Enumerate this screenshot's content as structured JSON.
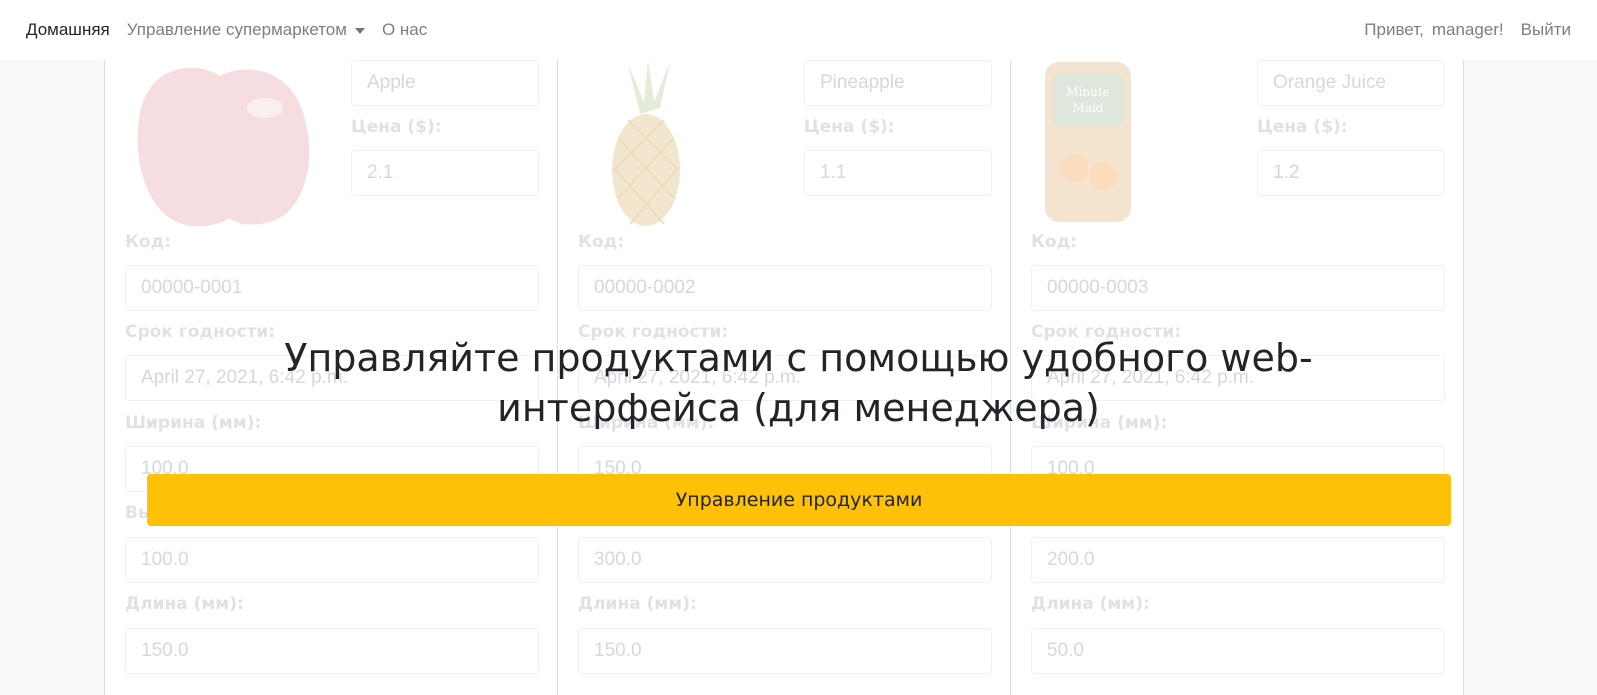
{
  "nav": {
    "home": "Домашняя",
    "manage": "Управление супермаркетом",
    "about": "О нас",
    "greeting": "Привет,",
    "username": "manager!",
    "logout": "Выйти"
  },
  "labels": {
    "price": "Цена ($):",
    "code": "Код:",
    "expiry": "Срок годности:",
    "width": "Ширина (мм):",
    "height": "Высота (мм):",
    "length": "Длина (мм):"
  },
  "products": [
    {
      "name": "Apple",
      "price": "2.1",
      "code": "00000-0001",
      "expiry": "April 27, 2021, 6:42 p.m.",
      "width": "100.0",
      "height": "100.0",
      "length": "150.0"
    },
    {
      "name": "Pineapple",
      "price": "1.1",
      "code": "00000-0002",
      "expiry": "April 27, 2021, 6:42 p.m.",
      "width": "150.0",
      "height": "300.0",
      "length": "150.0"
    },
    {
      "name": "Orange Juice",
      "price": "1.2",
      "code": "00000-0003",
      "expiry": "April 27, 2021, 6:42 p.m.",
      "width": "100.0",
      "height": "200.0",
      "length": "50.0"
    }
  ],
  "images": {
    "juice_label": "Minute Maid"
  },
  "hero": {
    "title_line1": "Управляйте продуктами с помощью удобного web-",
    "title_line2": "интерфейса (для менеджера)",
    "button": "Управление продуктами"
  },
  "colors": {
    "accent": "#ffc107",
    "card_border": "#cfe4e6"
  }
}
